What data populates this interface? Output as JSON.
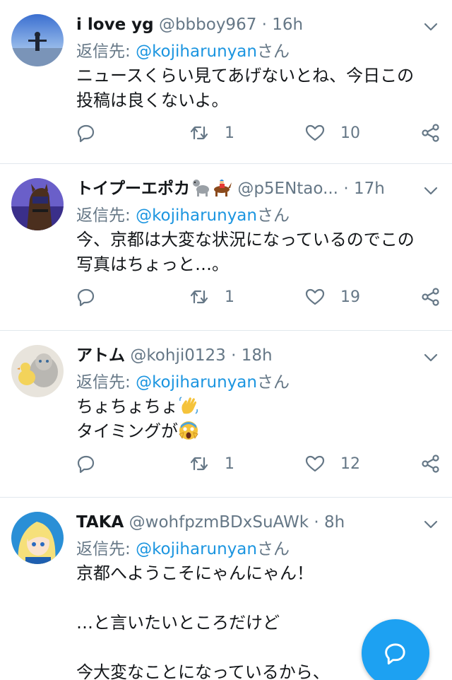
{
  "tweets": [
    {
      "name": "i love yg",
      "handle": "@bbboy967",
      "time": "16h",
      "reply_prefix": "返信先: ",
      "reply_mention": "@kojiharunyan",
      "reply_suffix": "さん",
      "lines": [
        "ニュースくらい見てあげないとね、今日この",
        "投稿は良くないよ。"
      ],
      "retweets": "1",
      "likes": "10"
    },
    {
      "name": "トイプーエポカ",
      "name_icons": [
        "poodle-emoji-icon",
        "horse-racing-emoji-icon"
      ],
      "handle": "@p5ENtao...",
      "time": "17h",
      "reply_prefix": "返信先: ",
      "reply_mention": "@kojiharunyan",
      "reply_suffix": "さん",
      "lines": [
        "今、京都は大変な状況になっているのでこの",
        "写真はちょっと…。"
      ],
      "retweets": "1",
      "likes": "19"
    },
    {
      "name": "アトム",
      "handle": "@kohji0123",
      "time": "18h",
      "reply_prefix": "返信先: ",
      "reply_mention": "@kojiharunyan",
      "reply_suffix": "さん",
      "lines": [
        "ちょちょちょ",
        "タイミングが"
      ],
      "line_icons": [
        "waving-hand-emoji-icon",
        "screaming-face-emoji-icon"
      ],
      "retweets": "1",
      "likes": "12"
    },
    {
      "name": "TAKA",
      "handle": "@wohfpzmBDxSuAWk",
      "time": "8h",
      "reply_prefix": "返信先: ",
      "reply_mention": "@kojiharunyan",
      "reply_suffix": "さん",
      "lines": [
        "京都へようこそにゃんにゃん！",
        "",
        "…と言いたいところだけど",
        "",
        "今大変なことになっているから、"
      ]
    }
  ],
  "separator": "·",
  "colors": {
    "accent": "#1da1f2",
    "mention": "#1b95e0",
    "muted": "#657786",
    "divider": "#e1e8ed",
    "text": "#14171a"
  },
  "fab_icon": "compose-reply-icon"
}
